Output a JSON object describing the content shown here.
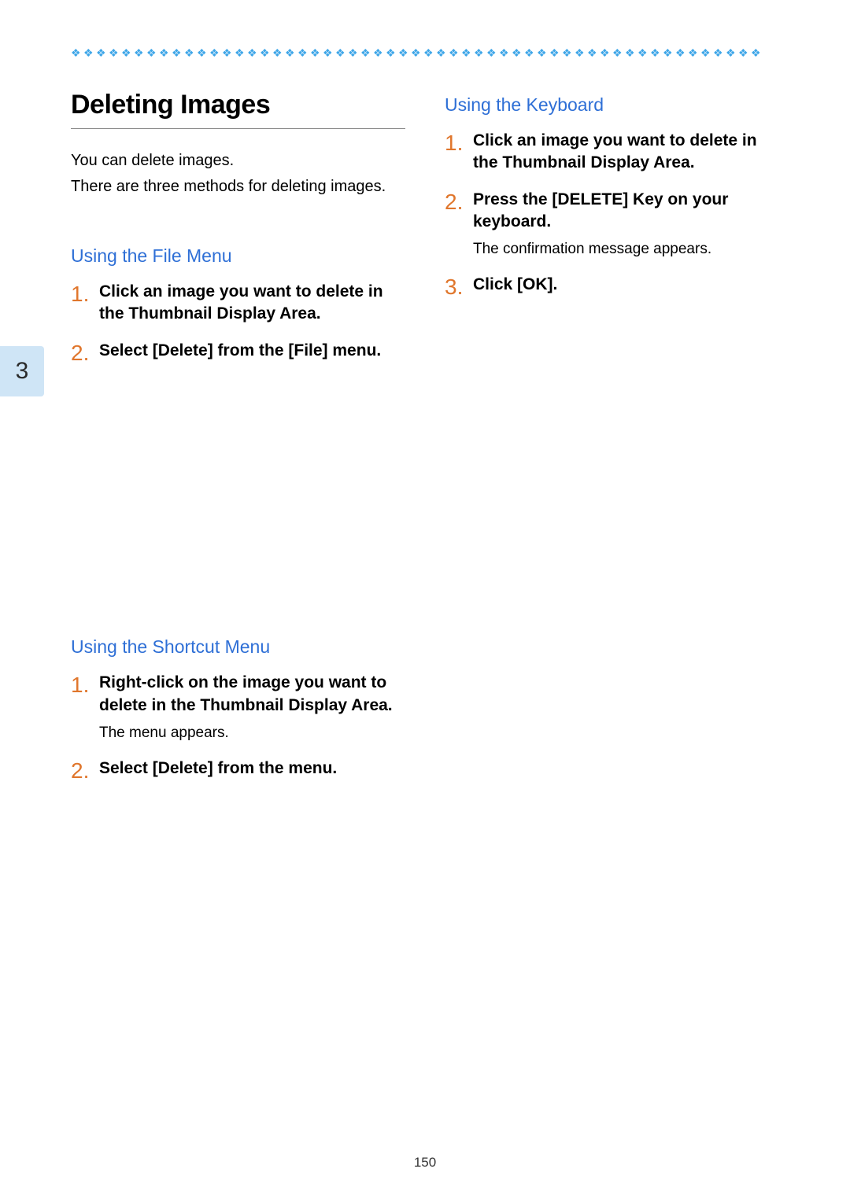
{
  "sideTab": "3",
  "pageNumber": "150",
  "heading": "Deleting Images",
  "intro": {
    "line1": "You can delete images.",
    "line2": "There are three methods for deleting images."
  },
  "leftCol": {
    "section1": {
      "title": "Using the File Menu",
      "steps": [
        {
          "num": "1.",
          "bold": "Click an image you want to delete in the Thumbnail Display Area."
        },
        {
          "num": "2.",
          "bold": "Select [Delete] from the [File] menu."
        }
      ]
    },
    "section2": {
      "title": "Using the Shortcut Menu",
      "steps": [
        {
          "num": "1.",
          "bold": "Right-click on the image you want to delete in the Thumbnail Display Area.",
          "note": "The menu appears."
        },
        {
          "num": "2.",
          "bold": "Select [Delete] from the menu."
        }
      ]
    }
  },
  "rightCol": {
    "section1": {
      "title": "Using the Keyboard",
      "steps": [
        {
          "num": "1.",
          "bold": "Click an image you want to delete in the Thumbnail Display Area."
        },
        {
          "num": "2.",
          "bold": "Press the [DELETE] Key on your keyboard.",
          "note": "The confirmation message appears."
        },
        {
          "num": "3.",
          "bold": "Click [OK]."
        }
      ]
    }
  }
}
